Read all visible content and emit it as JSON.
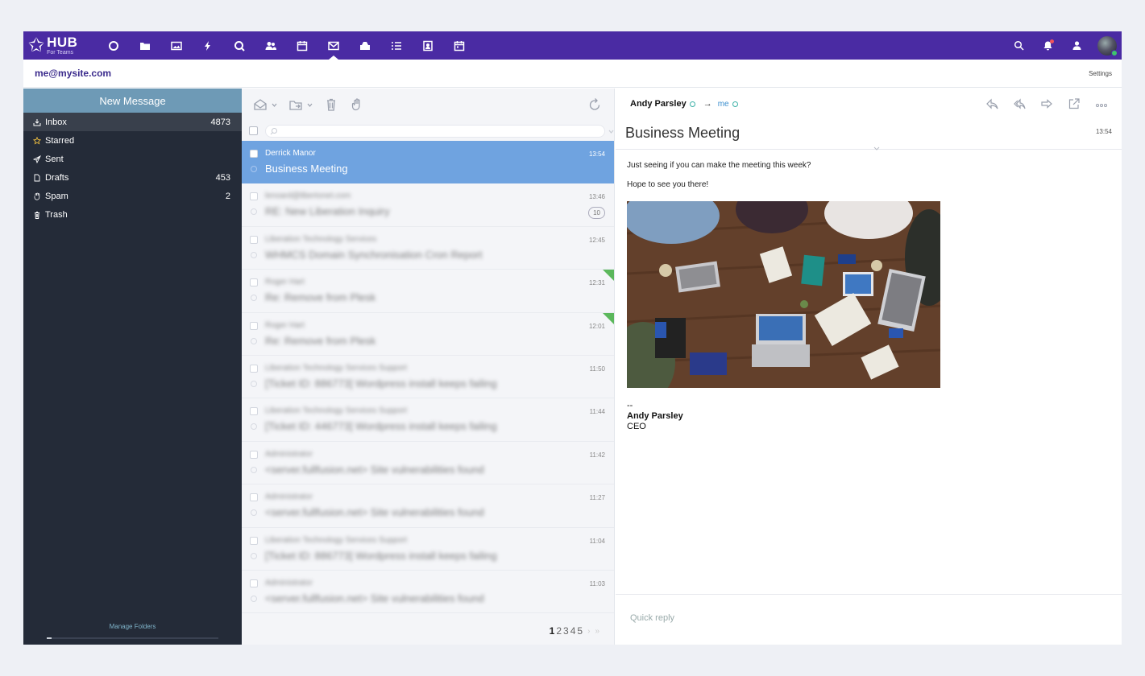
{
  "topbar": {
    "logo_text": "HUB",
    "logo_sub": "For Teams",
    "apps": [
      {
        "icon": "circle-icon"
      },
      {
        "icon": "folder-icon"
      },
      {
        "icon": "image-icon"
      },
      {
        "icon": "lightning-icon"
      },
      {
        "icon": "search-q-icon"
      },
      {
        "icon": "contacts-icon"
      },
      {
        "icon": "calendar-icon"
      },
      {
        "icon": "mail-icon",
        "active": true
      },
      {
        "icon": "briefcase-icon"
      },
      {
        "icon": "list-icon"
      },
      {
        "icon": "portrait-icon"
      },
      {
        "icon": "calendar-alt-icon"
      }
    ],
    "right_icons": [
      "search-icon",
      "notification-icon",
      "user-icon",
      "avatar"
    ],
    "brand_color": "#4a2ba3"
  },
  "account": {
    "email": "me@mysite.com",
    "settings_label": "Settings"
  },
  "sidebar": {
    "new_message_label": "New Message",
    "folders": [
      {
        "label": "Inbox",
        "count": "4873",
        "icon": "inbox-icon",
        "active": true
      },
      {
        "label": "Starred",
        "count": "",
        "icon": "star-icon"
      },
      {
        "label": "Sent",
        "count": "",
        "icon": "send-icon"
      },
      {
        "label": "Drafts",
        "count": "453",
        "icon": "draft-icon"
      },
      {
        "label": "Spam",
        "count": "2",
        "icon": "spam-icon"
      },
      {
        "label": "Trash",
        "count": "",
        "icon": "trash-icon"
      }
    ],
    "manage_folders_label": "Manage Folders",
    "quota_fraction": 0.03
  },
  "list": {
    "search": {
      "value": "",
      "placeholder": ""
    },
    "messages": [
      {
        "from": "Derrick Manor",
        "subject": "Business Meeting",
        "time": "13:54",
        "selected": true
      },
      {
        "from": "lenoard@libertonet.com",
        "subject": "RE: New Liberation Inquiry",
        "time": "13:46",
        "thread": "10"
      },
      {
        "from": "Liberation Technology Services",
        "subject": "WHMCS Domain Synchronisation Cron Report",
        "time": "12:45"
      },
      {
        "from": "Roger Hart",
        "subject": "Re: Remove from Plesk",
        "time": "12:31",
        "flagged": true
      },
      {
        "from": "Roger Hart",
        "subject": "Re: Remove from Plesk",
        "time": "12:01",
        "flagged": true
      },
      {
        "from": "Liberation Technology Services Support",
        "subject": "[Ticket ID: 886773] Wordpress install keeps failing",
        "time": "11:50"
      },
      {
        "from": "Liberation Technology Services Support",
        "subject": "[Ticket ID: 446773] Wordpress install keeps failing",
        "time": "11:44"
      },
      {
        "from": "Administrator",
        "subject": "<server.fullfusion.net> Site vulnerabilities found",
        "time": "11:42"
      },
      {
        "from": "Administrator",
        "subject": "<server.fullfusion.net> Site vulnerabilities found",
        "time": "11:27"
      },
      {
        "from": "Liberation Technology Services Support",
        "subject": "[Ticket ID: 886773] Wordpress install keeps failing",
        "time": "11:04"
      },
      {
        "from": "Administrator",
        "subject": "<server.fullfusion.net> Site vulnerabilities found",
        "time": "11:03"
      }
    ],
    "pages": [
      "1",
      "2",
      "3",
      "4",
      "5"
    ],
    "current_page": "1",
    "pager_next": "›",
    "pager_last": "»"
  },
  "reader": {
    "from": "Andy Parsley",
    "arrow": "→",
    "to": "me",
    "subject": "Business Meeting",
    "time": "13:54",
    "body": [
      "Just seeing if you can make the meeting this week?",
      "Hope to see you there!"
    ],
    "sig_dashes": "--",
    "sig_name": "Andy Parsley",
    "sig_title": "CEO",
    "quick_reply_placeholder": "Quick reply",
    "actions": [
      "reply-icon",
      "reply-all-icon",
      "forward-icon",
      "popout-icon",
      "more-icon"
    ]
  }
}
